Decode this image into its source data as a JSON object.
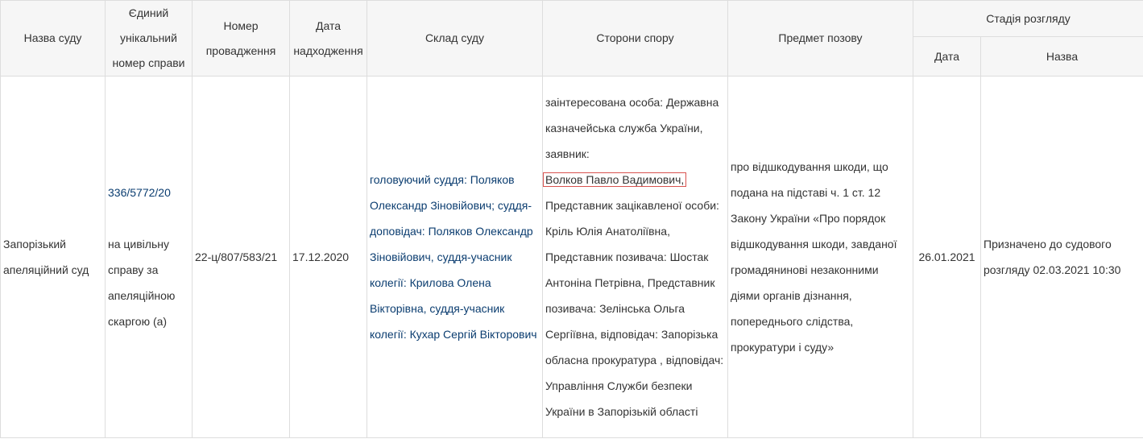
{
  "table": {
    "headers": {
      "court_name": "Назва суду",
      "case_number": "Єдиний унікальний номер справи",
      "proceeding_number": "Номер провадження",
      "receipt_date": "Дата надходження",
      "court_composition": "Склад суду",
      "parties": "Сторони спору",
      "subject": "Предмет позову",
      "stage": "Стадія розгляду",
      "stage_date": "Дата",
      "stage_name": "Назва"
    },
    "row": {
      "court_name": "Запорізький апеляційний суд",
      "case_number": "336/5772/20",
      "case_desc": "на цивільну справу за апеляційною скаргою (а)",
      "proceeding_number": "22-ц/807/583/21",
      "receipt_date": "17.12.2020",
      "court_composition": "головуючий суддя: Поляков Олександр Зіновійович; суддя-доповідач: Поляков Олександр Зіновійович, суддя-учасник колегії: Крилова Олена Вікторівна, суддя-учасник колегії: Кухар Сергій Вікторович",
      "parties_before": "заінтересована особа: Державна казначейська служба України, заявник:",
      "parties_highlight": "Волков Павло Вадимович,",
      "parties_after": "Представник зацікавленої особи: Кріль Юлія Анатоліївна, Представник позивача: Шостак Антоніна Петрівна, Представник позивача: Зелінська Ольга Сергіївна, відповідач: Запорізька обласна прокуратура , відповідач: Управління Служби безпеки України в Запорізькій області",
      "subject": "про відшкодування шкоди, що подана на підставі ч. 1 ст. 12 Закону України «Про порядок відшкодування шкоди, завданої громадянинові незаконними діями органів дізнання, попереднього слідства, прокуратури і суду»",
      "stage_date": "26.01.2021",
      "stage_name": "Призначено до судового розгляду 02.03.2021 10:30"
    }
  },
  "colors": {
    "link": "#0b3d70",
    "highlight_border": "#d9534f",
    "header_bg": "#f6f6f6",
    "border": "#dddddd"
  }
}
